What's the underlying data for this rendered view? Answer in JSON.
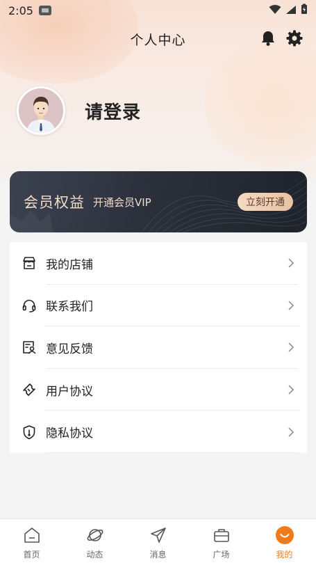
{
  "status_bar": {
    "time": "2:05"
  },
  "header": {
    "title": "个人中心"
  },
  "profile": {
    "login_label": "请登录"
  },
  "vip": {
    "title": "会员权益",
    "subtitle": "开通会员VIP",
    "button_label": "立刻开通"
  },
  "menu": {
    "items": [
      {
        "label": "我的店铺",
        "icon": "store-icon"
      },
      {
        "label": "联系我们",
        "icon": "headset-icon"
      },
      {
        "label": "意见反馈",
        "icon": "feedback-icon"
      },
      {
        "label": "用户协议",
        "icon": "ticket-icon"
      },
      {
        "label": "隐私协议",
        "icon": "shield-icon"
      }
    ]
  },
  "bottom_nav": {
    "items": [
      {
        "label": "首页",
        "icon": "home-icon"
      },
      {
        "label": "动态",
        "icon": "planet-icon"
      },
      {
        "label": "消息",
        "icon": "send-icon"
      },
      {
        "label": "广场",
        "icon": "briefcase-icon"
      },
      {
        "label": "我的",
        "icon": "smile-icon",
        "active": true
      }
    ]
  },
  "colors": {
    "accent": "#f07a1a",
    "vip_gold": "#f2dcc8",
    "vip_dark": "#2a2f3a"
  }
}
